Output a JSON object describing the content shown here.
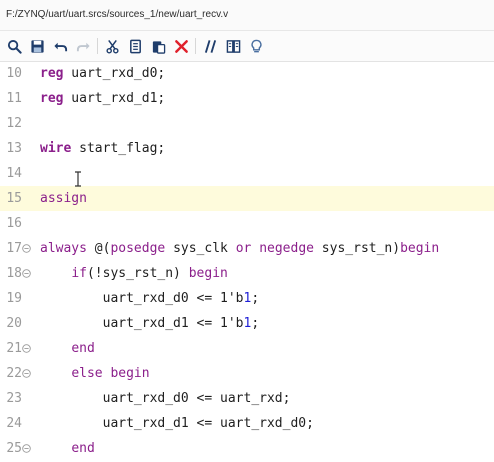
{
  "path": "F:/ZYNQ/uart/uart.srcs/sources_1/new/uart_recv.v",
  "toolbar": [
    {
      "name": "search-icon"
    },
    {
      "name": "save-icon"
    },
    {
      "name": "undo-icon"
    },
    {
      "name": "redo-icon"
    },
    {
      "name": "cut-icon"
    },
    {
      "name": "copy-icon"
    },
    {
      "name": "paste-icon"
    },
    {
      "name": "delete-icon"
    },
    {
      "name": "comment-icon"
    },
    {
      "name": "toggle-columns-icon"
    },
    {
      "name": "lightbulb-icon"
    }
  ],
  "colors": {
    "keyword": "#8b1f8b",
    "number": "#1f1fd6",
    "highlight_line": "#fefbdc",
    "delete": "#e0202b",
    "icon": "#1f3d6b"
  },
  "lines": [
    {
      "num": "10",
      "fold": "",
      "highlight": false,
      "tokens": [
        {
          "t": "reg",
          "c": "kw"
        },
        {
          "t": " uart_rxd_d0;",
          "c": ""
        }
      ]
    },
    {
      "num": "11",
      "fold": "",
      "highlight": false,
      "tokens": [
        {
          "t": "reg",
          "c": "kw"
        },
        {
          "t": " uart_rxd_d1;",
          "c": ""
        }
      ]
    },
    {
      "num": "12",
      "fold": "",
      "highlight": false,
      "tokens": []
    },
    {
      "num": "13",
      "fold": "",
      "highlight": false,
      "tokens": [
        {
          "t": "wire",
          "c": "kw"
        },
        {
          "t": " start_flag;",
          "c": ""
        }
      ]
    },
    {
      "num": "14",
      "fold": "",
      "highlight": false,
      "tokens": []
    },
    {
      "num": "15",
      "fold": "",
      "highlight": true,
      "tokens": [
        {
          "t": "assign",
          "c": "kw2"
        }
      ]
    },
    {
      "num": "16",
      "fold": "",
      "highlight": false,
      "tokens": []
    },
    {
      "num": "17",
      "fold": "open",
      "highlight": false,
      "tokens": [
        {
          "t": "always",
          "c": "kw2"
        },
        {
          "t": " @(",
          "c": ""
        },
        {
          "t": "posedge",
          "c": "kw2"
        },
        {
          "t": " sys_clk ",
          "c": ""
        },
        {
          "t": "or",
          "c": "kw2"
        },
        {
          "t": " ",
          "c": ""
        },
        {
          "t": "negedge",
          "c": "kw2"
        },
        {
          "t": " sys_rst_n)",
          "c": ""
        },
        {
          "t": "begin",
          "c": "kw2"
        }
      ]
    },
    {
      "num": "18",
      "fold": "open",
      "highlight": false,
      "tokens": [
        {
          "t": "    ",
          "c": ""
        },
        {
          "t": "if",
          "c": "kw2"
        },
        {
          "t": "(!sys_rst_n) ",
          "c": ""
        },
        {
          "t": "begin",
          "c": "kw2"
        }
      ]
    },
    {
      "num": "19",
      "fold": "",
      "highlight": false,
      "tokens": [
        {
          "t": "        uart_rxd_d0 <= 1'b",
          "c": ""
        },
        {
          "t": "1",
          "c": "num"
        },
        {
          "t": ";",
          "c": ""
        }
      ]
    },
    {
      "num": "20",
      "fold": "",
      "highlight": false,
      "tokens": [
        {
          "t": "        uart_rxd_d1 <= 1'b",
          "c": ""
        },
        {
          "t": "1",
          "c": "num"
        },
        {
          "t": ";",
          "c": ""
        }
      ]
    },
    {
      "num": "21",
      "fold": "close",
      "highlight": false,
      "tokens": [
        {
          "t": "    ",
          "c": ""
        },
        {
          "t": "end",
          "c": "kw2"
        }
      ]
    },
    {
      "num": "22",
      "fold": "open",
      "highlight": false,
      "tokens": [
        {
          "t": "    ",
          "c": ""
        },
        {
          "t": "else",
          "c": "kw2"
        },
        {
          "t": " ",
          "c": ""
        },
        {
          "t": "begin",
          "c": "kw2"
        }
      ]
    },
    {
      "num": "23",
      "fold": "",
      "highlight": false,
      "tokens": [
        {
          "t": "        uart_rxd_d0 <= uart_rxd;",
          "c": ""
        }
      ]
    },
    {
      "num": "24",
      "fold": "",
      "highlight": false,
      "tokens": [
        {
          "t": "        uart_rxd_d1 <= uart_rxd_d0;",
          "c": ""
        }
      ]
    },
    {
      "num": "25",
      "fold": "close",
      "highlight": false,
      "tokens": [
        {
          "t": "    ",
          "c": ""
        },
        {
          "t": "end",
          "c": "kw2"
        }
      ]
    }
  ]
}
